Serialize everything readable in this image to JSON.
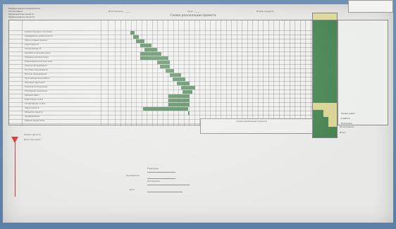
{
  "image": {
    "title": "Схема реализации проекта"
  },
  "header": {
    "left_lines": [
      "Наименование предприятия",
      "Согласовано",
      "Руководитель проекта",
      "Наименование проекта"
    ],
    "mid_text": "Исполнитель: ______",
    "mid2_text": "Срок: ______",
    "right_text": "Этапы проекта"
  },
  "tasks": [
    "Анализ текущего состояния",
    "Определение целей проекта",
    "Сбор исходных данных",
    "Подготовка ТЗ",
    "Согласование ТЗ",
    "Разработка документации",
    "Проверка документации",
    "Утверждение документации",
    "Закупка оборудования",
    "Поставка оборудования",
    "Монтаж оборудования",
    "Пусконаладочные работы",
    "Обучение персонала",
    "Опытная эксплуатация",
    "Устранение замечаний",
    "Приёмка работ",
    "Подготовка отчёта",
    "Согласование отчёта",
    "Сдача проекта",
    "Закрытие проекта",
    "Архивирование",
    "Оценка результатов"
  ],
  "right_panel": {
    "labels": [
      "Начало работ",
      "В работе",
      "Исполнено",
      "Не исполнено",
      "Итого"
    ]
  },
  "sub_table": {
    "caption": "Схема реализации проекта"
  },
  "legend": {
    "item1": "Начало проекта",
    "item2": "Дата окончания"
  },
  "signatures": {
    "approved": "Утверждаю",
    "role1": "Руководитель",
    "role2": "Исполнитель",
    "date": "Дата"
  },
  "colors": {
    "bar": "#3f7d4a",
    "summary": "#3f7d4a",
    "highlight": "#d7d28f",
    "marker": "#cc3333"
  }
}
